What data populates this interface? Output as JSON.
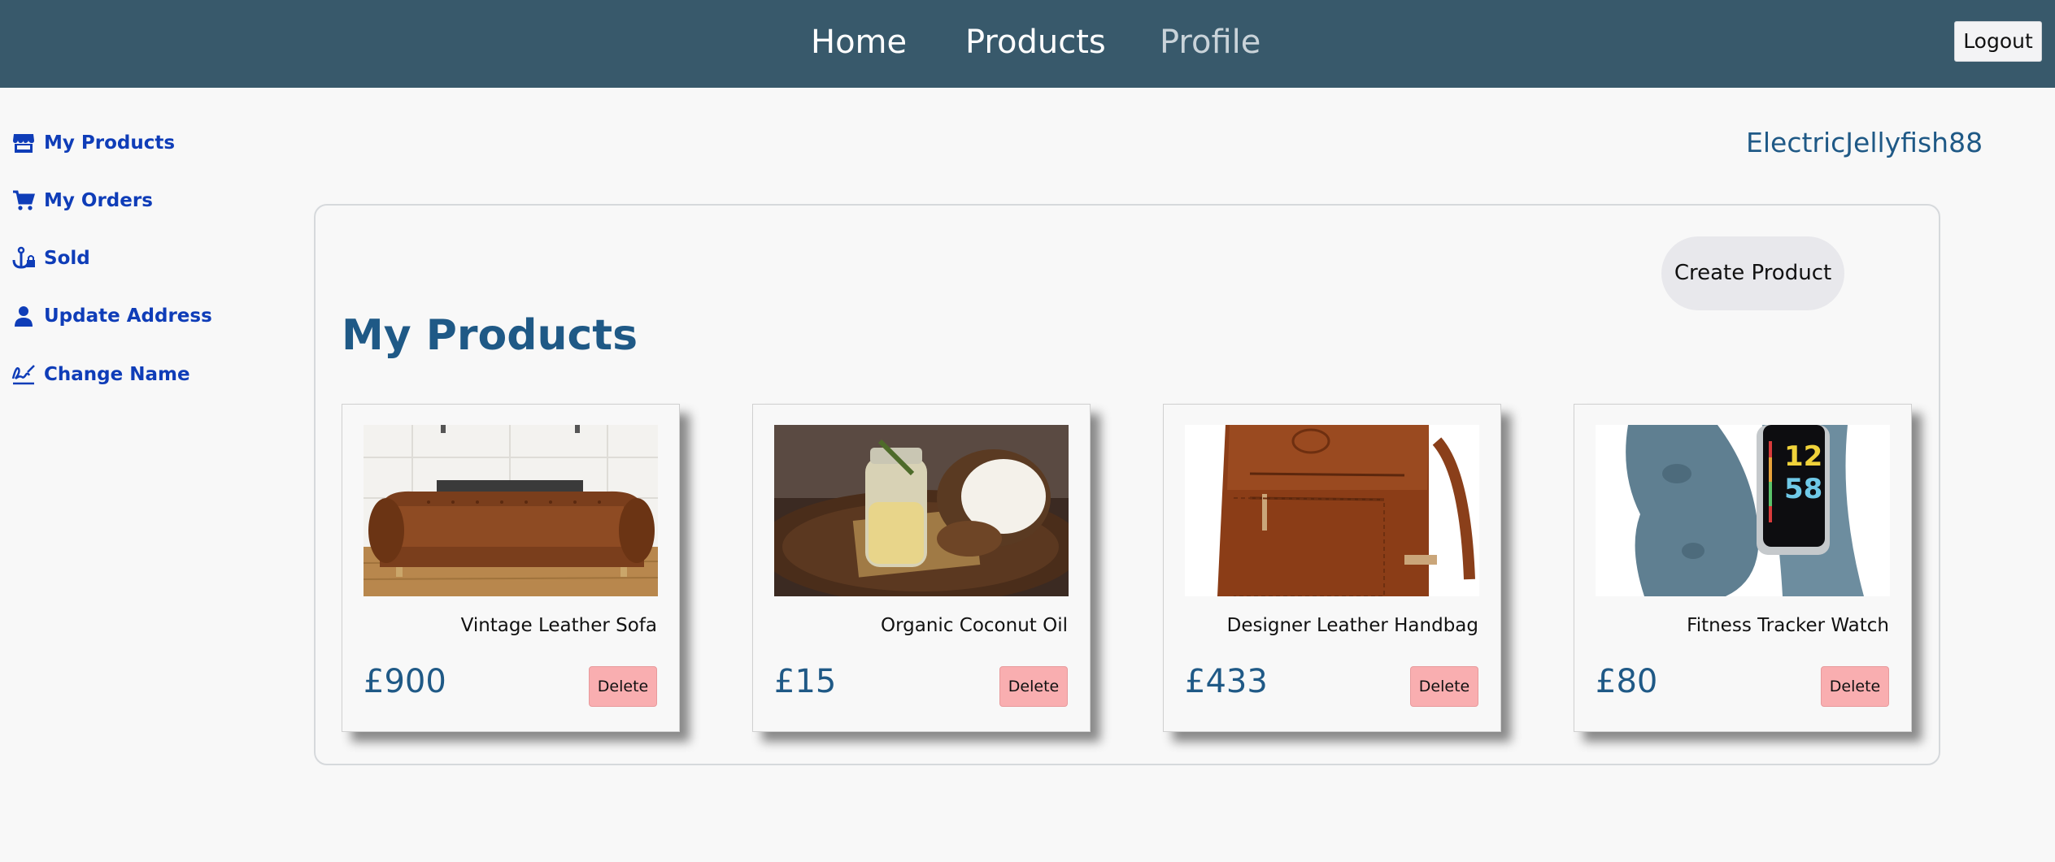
{
  "nav": {
    "home": "Home",
    "products": "Products",
    "profile": "Profile",
    "logout": "Logout"
  },
  "sidebar": {
    "items": [
      {
        "label": "My Products",
        "icon": "store-icon"
      },
      {
        "label": "My Orders",
        "icon": "cart-icon"
      },
      {
        "label": "Sold",
        "icon": "anchor-lock-icon"
      },
      {
        "label": "Update Address",
        "icon": "user-icon"
      },
      {
        "label": "Change Name",
        "icon": "signature-icon"
      }
    ]
  },
  "username": "ElectricJellyfish88",
  "main": {
    "title": "My Products",
    "create_button": "Create Product",
    "products": [
      {
        "name": "Vintage Leather Sofa",
        "price": "£900",
        "delete": "Delete",
        "image": "leather-sofa"
      },
      {
        "name": "Organic Coconut Oil",
        "price": "£15",
        "delete": "Delete",
        "image": "coconut-oil"
      },
      {
        "name": "Designer Leather Handbag",
        "price": "£433",
        "delete": "Delete",
        "image": "leather-handbag"
      },
      {
        "name": "Fitness Tracker Watch",
        "price": "£80",
        "delete": "Delete",
        "image": "fitness-tracker",
        "watch_time": [
          "12",
          "58"
        ]
      }
    ]
  },
  "colors": {
    "topbar": "#38596b",
    "accent": "#1f5986",
    "sidebar_link": "#0f3db8",
    "delete_button": "#f9aeb0"
  }
}
